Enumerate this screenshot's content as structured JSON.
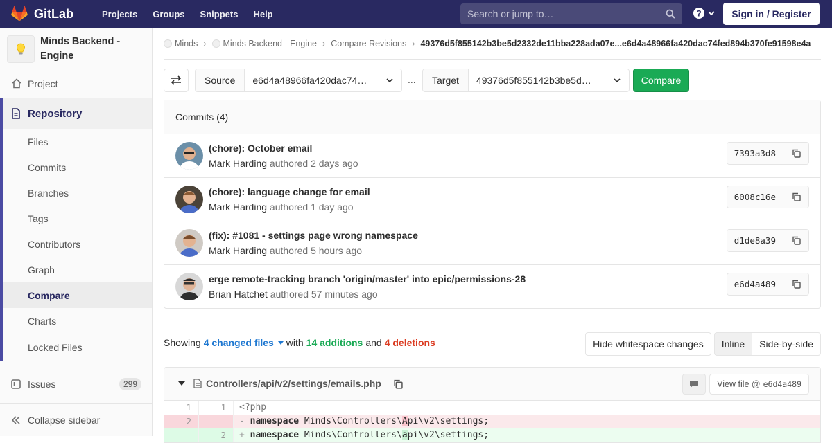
{
  "nav": {
    "brand": "GitLab",
    "links": [
      "Projects",
      "Groups",
      "Snippets",
      "Help"
    ],
    "search_placeholder": "Search or jump to…",
    "signin": "Sign in / Register"
  },
  "sidebar": {
    "project_title": "Minds Backend - Engine",
    "project_item": "Project",
    "repository": "Repository",
    "repo_items": [
      "Files",
      "Commits",
      "Branches",
      "Tags",
      "Contributors",
      "Graph",
      "Compare",
      "Charts",
      "Locked Files"
    ],
    "active_item": "Compare",
    "issues_label": "Issues",
    "issues_count": "299",
    "collapse": "Collapse sidebar"
  },
  "breadcrumb": {
    "items": [
      "Minds",
      "Minds Backend - Engine",
      "Compare Revisions"
    ],
    "current": "49376d5f855142b3be5d2332de11bba228ada07e...e6d4a48966fa420dac74fed894b370fe91598e4a"
  },
  "compare": {
    "source_label": "Source",
    "source_value": "e6d4a48966fa420dac74…",
    "ellipsis": "...",
    "target_label": "Target",
    "target_value": "49376d5f855142b3be5d…",
    "button": "Compare"
  },
  "commits": {
    "header": "Commits (4)",
    "items": [
      {
        "title": "(chore): October email",
        "author": "Mark Harding",
        "time": "authored 2 days ago",
        "sha": "7393a3d8"
      },
      {
        "title": "(chore): language change for email",
        "author": "Mark Harding",
        "time": "authored 1 day ago",
        "sha": "6008c16e"
      },
      {
        "title": "(fix): #1081 - settings page wrong namespace",
        "author": "Mark Harding",
        "time": "authored 5 hours ago",
        "sha": "d1de8a39"
      },
      {
        "title": "erge remote-tracking branch 'origin/master' into epic/permissions-28",
        "author": "Brian Hatchet",
        "time": "authored 57 minutes ago",
        "sha": "e6d4a489"
      }
    ]
  },
  "summary": {
    "showing": "Showing",
    "changed": "4 changed files",
    "with": "with",
    "additions": "14 additions",
    "and": "and",
    "deletions": "4 deletions"
  },
  "view": {
    "whitespace": "Hide whitespace changes",
    "inline": "Inline",
    "sbs": "Side-by-side"
  },
  "file": {
    "path": "Controllers/api/v2/settings/emails.php",
    "view_file": "View file @",
    "view_sha": "e6d4a489",
    "lines": [
      {
        "type": "ctx",
        "old": "1",
        "new": "1",
        "sign": " ",
        "text": "<?php"
      },
      {
        "type": "old",
        "old": "2",
        "new": "",
        "sign": "-",
        "kw": "namespace",
        "pre": " Minds\\Controllers\\",
        "hl": "A",
        "post": "pi\\v2\\settings;"
      },
      {
        "type": "new",
        "old": "",
        "new": "2",
        "sign": "+",
        "kw": "namespace",
        "pre": " Minds\\Controllers\\",
        "hl": "a",
        "post": "pi\\v2\\settings;"
      }
    ]
  }
}
